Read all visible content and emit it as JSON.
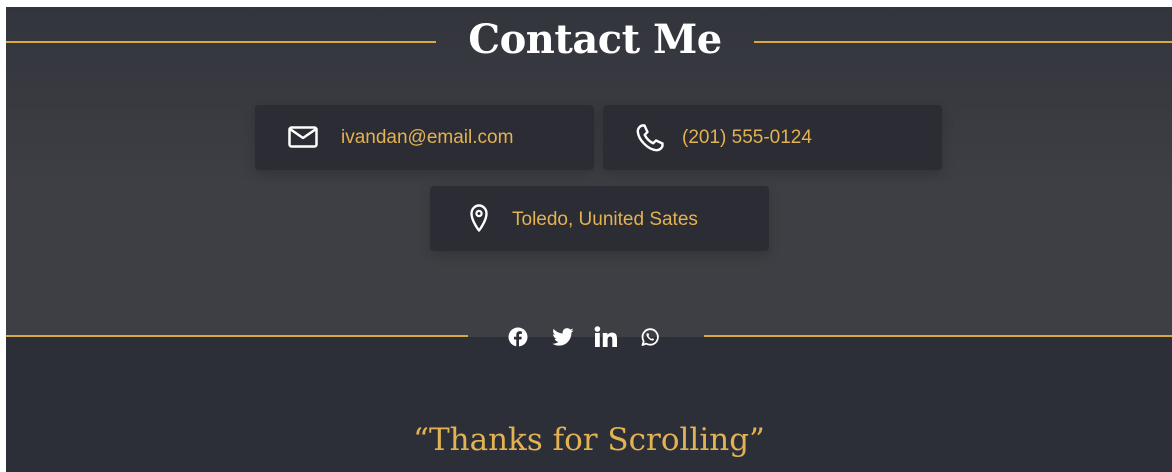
{
  "contact": {
    "title": "Contact Me",
    "email": {
      "icon": "mail-icon",
      "text": "ivandan@email.com"
    },
    "phone": {
      "icon": "phone-icon",
      "text": "(201) 555-0124"
    },
    "location": {
      "icon": "map-pin-icon",
      "text": "Toledo, Uunited Sates"
    }
  },
  "socials": [
    {
      "name": "facebook",
      "icon": "facebook-icon"
    },
    {
      "name": "twitter",
      "icon": "twitter-icon"
    },
    {
      "name": "linkedin",
      "icon": "linkedin-icon"
    },
    {
      "name": "whatsapp",
      "icon": "whatsapp-icon"
    }
  ],
  "footer": {
    "quote": "“Thanks for Scrolling”"
  },
  "colors": {
    "accent": "#d9a83f",
    "accent_text": "#e3b251",
    "background_dark": "#2d2f38",
    "card_background": "#2b2c34",
    "title_text": "#ffffff"
  }
}
